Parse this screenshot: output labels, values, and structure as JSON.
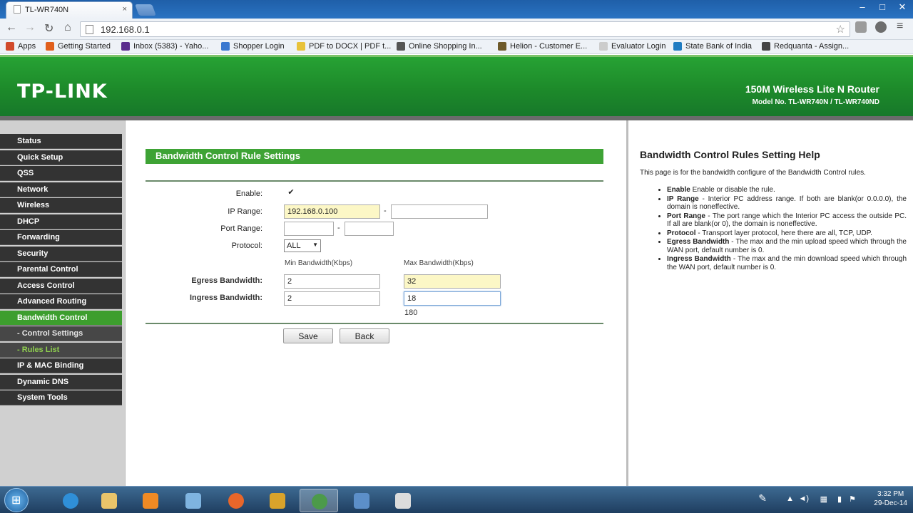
{
  "browser": {
    "tab_title": "TL-WR740N",
    "tab_close": "×",
    "window_controls": [
      "–",
      "□",
      "✕"
    ],
    "url": "192.168.0.1",
    "bookmarks": [
      {
        "label": "Apps",
        "color": "#d14a2b"
      },
      {
        "label": "Getting Started",
        "color": "#e05f1c"
      },
      {
        "label": "Inbox (5383) - Yaho...",
        "color": "#5b2d8e"
      },
      {
        "label": "Shopper Login",
        "color": "#3a78d0"
      },
      {
        "label": "PDF to DOCX | PDF t...",
        "color": "#e8c23a"
      },
      {
        "label": "Online Shopping In...",
        "color": "#555555"
      },
      {
        "label": "Helion - Customer E...",
        "color": "#6e5a2a"
      },
      {
        "label": "Evaluator Login",
        "color": "#cccccc"
      },
      {
        "label": "State Bank of India",
        "color": "#1f7bc1"
      },
      {
        "label": "Redquanta - Assign...",
        "color": "#444444"
      }
    ]
  },
  "router": {
    "logo": "TP-LINK",
    "product_name": "150M Wireless Lite N Router",
    "model": "Model No. TL-WR740N / TL-WR740ND"
  },
  "menu": [
    {
      "label": "Status",
      "type": "main"
    },
    {
      "label": "Quick Setup",
      "type": "main"
    },
    {
      "label": "QSS",
      "type": "main"
    },
    {
      "label": "Network",
      "type": "main"
    },
    {
      "label": "Wireless",
      "type": "main"
    },
    {
      "label": "DHCP",
      "type": "main"
    },
    {
      "label": "Forwarding",
      "type": "main"
    },
    {
      "label": "Security",
      "type": "main"
    },
    {
      "label": "Parental Control",
      "type": "main"
    },
    {
      "label": "Access Control",
      "type": "main"
    },
    {
      "label": "Advanced Routing",
      "type": "main"
    },
    {
      "label": "Bandwidth Control",
      "type": "active"
    },
    {
      "label": "- Control Settings",
      "type": "sub"
    },
    {
      "label": "- Rules List",
      "type": "sub-current"
    },
    {
      "label": "IP & MAC Binding",
      "type": "main"
    },
    {
      "label": "Dynamic DNS",
      "type": "main"
    },
    {
      "label": "System Tools",
      "type": "main"
    }
  ],
  "form": {
    "title": "Bandwidth Control Rule Settings",
    "enable_label": "Enable:",
    "enable_checked": true,
    "ip_range_label": "IP Range:",
    "ip_start": "192.168.0.100",
    "ip_end": "",
    "port_range_label": "Port Range:",
    "port_start": "",
    "port_end": "",
    "range_sep": "-",
    "protocol_label": "Protocol:",
    "protocol_value": "ALL",
    "min_bw_header": "Min Bandwidth(Kbps)",
    "max_bw_header": "Max Bandwidth(Kbps)",
    "egress_label": "Egress Bandwidth:",
    "egress_min": "2",
    "egress_max": "32",
    "ingress_label": "Ingress Bandwidth:",
    "ingress_min": "2",
    "ingress_max": "18",
    "autocomplete_suggestion": "180",
    "save_label": "Save",
    "back_label": "Back"
  },
  "help": {
    "title": "Bandwidth Control Rules Setting Help",
    "intro": "This page is for the bandwidth configure of the Bandwidth Control rules.",
    "items": [
      {
        "term": "Enable",
        "desc": " Enable or disable the rule."
      },
      {
        "term": "IP Range",
        "desc": " - Interior PC address range. If both are blank(or 0.0.0.0), the domain is noneffective."
      },
      {
        "term": "Port Range",
        "desc": " - The port range which the Interior PC access the outside PC. If all are blank(or 0), the domain is noneffective."
      },
      {
        "term": "Protocol",
        "desc": " - Transport layer protocol, here there are all, TCP, UDP."
      },
      {
        "term": "Egress Bandwidth",
        "desc": " - The max and the min upload speed which through the WAN port, default number is 0."
      },
      {
        "term": "Ingress Bandwidth",
        "desc": " - The max and the min download speed which through the WAN port, default number is 0."
      }
    ]
  },
  "taskbar": {
    "time": "3:32 PM",
    "date": "29-Dec-14",
    "apps": [
      {
        "name": "internet-explorer",
        "color": "#2f8fd8"
      },
      {
        "name": "file-explorer",
        "color": "#e9c46a"
      },
      {
        "name": "media-player",
        "color": "#f08a24"
      },
      {
        "name": "network-app",
        "color": "#7fb4e0"
      },
      {
        "name": "firefox",
        "color": "#e8662a"
      },
      {
        "name": "paint-app",
        "color": "#d9a32b"
      },
      {
        "name": "chrome",
        "color": "#4c9a4a"
      },
      {
        "name": "remote-desktop",
        "color": "#5c8fc9"
      },
      {
        "name": "notes-app",
        "color": "#dcdcdc"
      }
    ]
  }
}
